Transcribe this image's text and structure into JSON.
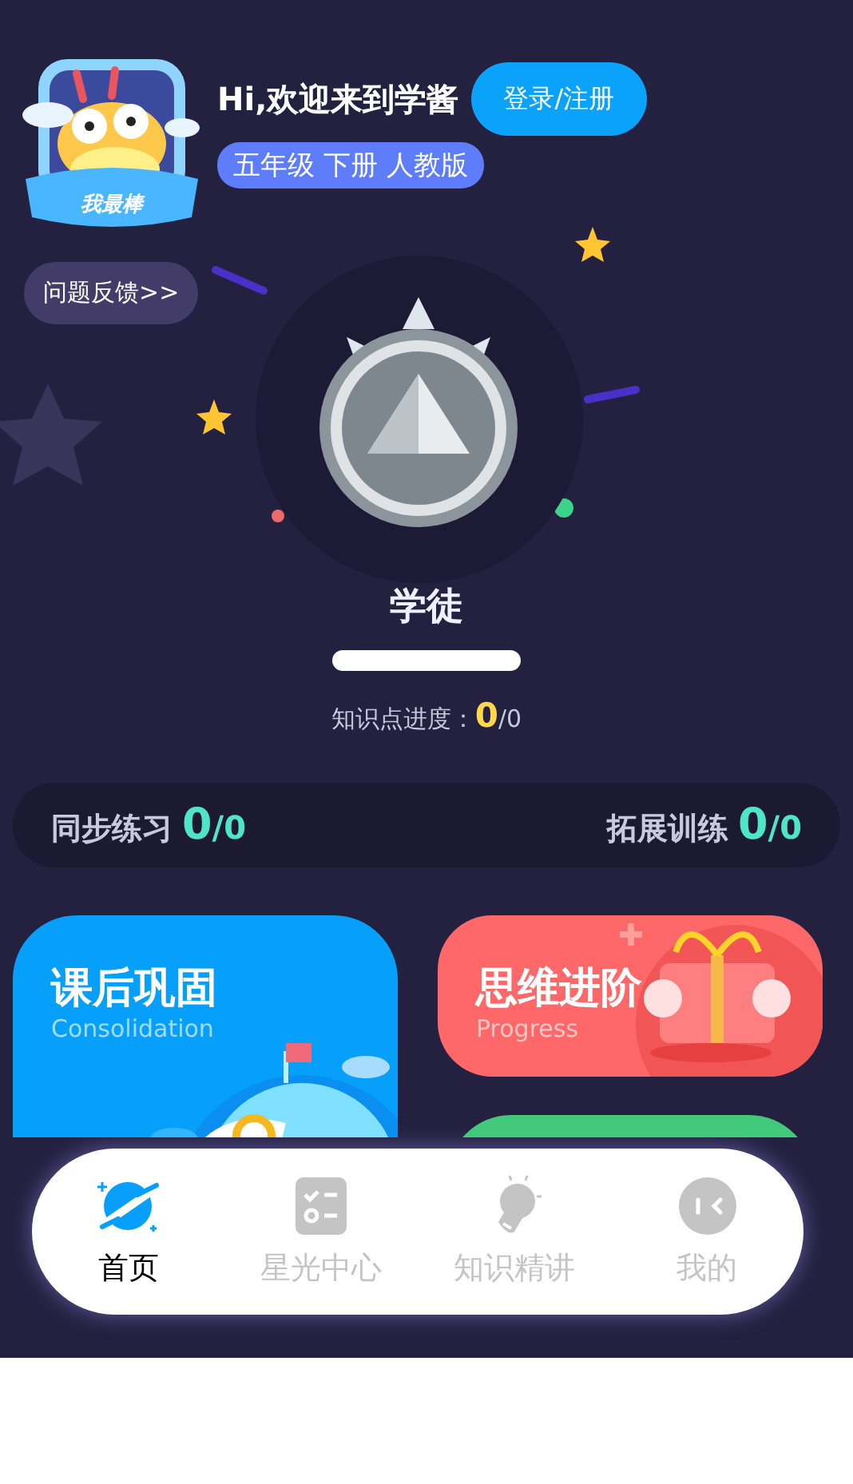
{
  "header": {
    "avatar_badge": "我最棒",
    "greeting": "Hi,欢迎来到学酱",
    "login_button": "登录/注册",
    "grade": "五年级 下册 人教版"
  },
  "feedback_button": "问题反馈>>",
  "rank": {
    "title": "学徒",
    "progress": {
      "level": 0
    },
    "progress_label": "知识点进度：",
    "progress_done": "0",
    "progress_total": "/0"
  },
  "stats": [
    {
      "label": "同步练习",
      "done": "0",
      "total": "/0"
    },
    {
      "label": "拓展训练",
      "done": "0",
      "total": "/0"
    }
  ],
  "cards": [
    {
      "kind": "consolidation",
      "title": "课后巩固",
      "subtitle": "Consolidation"
    },
    {
      "kind": "progress",
      "title": "思维进阶",
      "subtitle": "Progress"
    },
    {
      "kind": "plain"
    }
  ],
  "tab_bar": [
    {
      "kind": "home",
      "label": "首页",
      "selected": true
    },
    {
      "kind": "tasks",
      "label": "星光中心",
      "selected": false
    },
    {
      "kind": "idea",
      "label": "知识精讲",
      "selected": false
    },
    {
      "kind": "profile",
      "label": "我的",
      "selected": false
    }
  ]
}
